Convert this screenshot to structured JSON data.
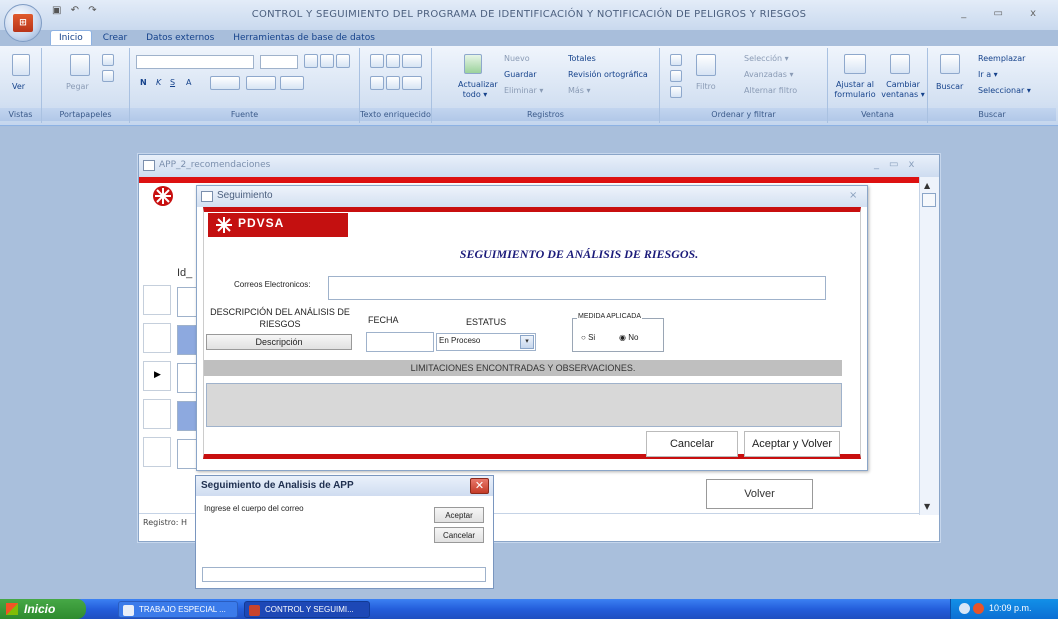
{
  "window": {
    "title": "CONTROL Y SEGUIMIENTO DEL PROGRAMA DE IDENTIFICACIÓN Y NOTIFICACIÓN DE PELIGROS Y RIESGOS",
    "office_button_label": "Office",
    "controls": "_ ▭ x"
  },
  "ribbon": {
    "tabs": [
      "Inicio",
      "Crear",
      "Datos externos",
      "Herramientas de base de datos"
    ],
    "groups": {
      "vistas": {
        "label": "Vistas",
        "ver": "Ver"
      },
      "portapapeles": {
        "label": "Portapapeles",
        "pegar": "Pegar"
      },
      "fuente": {
        "label": "Fuente",
        "bold": "N",
        "italic": "K",
        "underline": "S",
        "font_color": "A"
      },
      "texto": {
        "label": "Texto enriquecido"
      },
      "registros": {
        "label": "Registros",
        "actualizar": "Actualizar todo ▾",
        "nuevo": "Nuevo",
        "guardar": "Guardar",
        "eliminar": "Eliminar ▾",
        "totales": "Totales",
        "revision": "Revisión ortográfica",
        "mas": "Más ▾"
      },
      "ordenar": {
        "label": "Ordenar y filtrar",
        "filtro": "Filtro",
        "seleccion": "Selección ▾",
        "avanzadas": "Avanzadas ▾",
        "alternar": "Alternar filtro"
      },
      "ventana": {
        "label": "Ventana",
        "ajustar": "Ajustar al formulario",
        "cambiar": "Cambiar ventanas ▾"
      },
      "buscar": {
        "label": "Buscar",
        "buscar": "Buscar",
        "reemplazar": "Reemplazar",
        "ira": "Ir a ▾",
        "seleccionar": "Seleccionar ▾"
      }
    }
  },
  "app2": {
    "title": "APP_2_recomendaciones",
    "id_label": "Id_",
    "registro": "Registro: H",
    "volver": "Volver"
  },
  "seguimiento": {
    "title": "Seguimiento",
    "logo": "PDVSA",
    "heading": "SEGUIMIENTO DE ANÁLISIS DE RIESGOS.",
    "correos_label": "Correos Electronicos:",
    "correos_value": "",
    "descripcion_label": "DESCRIPCIÓN DEL ANÁLISIS DE RIESGOS",
    "descripcion_button": "Descripción",
    "fecha_label": "FECHA",
    "fecha_value": "",
    "estatus_label": "ESTATUS",
    "estatus_value": "En Proceso",
    "medida_label": "MEDIDA APLICADA",
    "medida_si": "Si",
    "medida_no": "No",
    "medida_selected": "No",
    "limitaciones_label": "LIMITACIONES ENCONTRADAS  Y OBSERVACIONES.",
    "cancelar": "Cancelar",
    "aceptar_volver": "Aceptar y Volver"
  },
  "message_box": {
    "title": "Seguimiento de Analisis de APP",
    "prompt": "Ingrese el cuerpo del correo",
    "aceptar": "Aceptar",
    "cancelar": "Cancelar",
    "input_value": ""
  },
  "taskbar": {
    "start": "Inicio",
    "items": [
      "TRABAJO ESPECIAL ...",
      "CONTROL Y SEGUIMI..."
    ],
    "clock": "10:09 p.m."
  },
  "colors": {
    "pdvsa_red": "#c80f0f",
    "ribbon_blue": "#15428b",
    "taskbar_blue": "#245edb"
  }
}
